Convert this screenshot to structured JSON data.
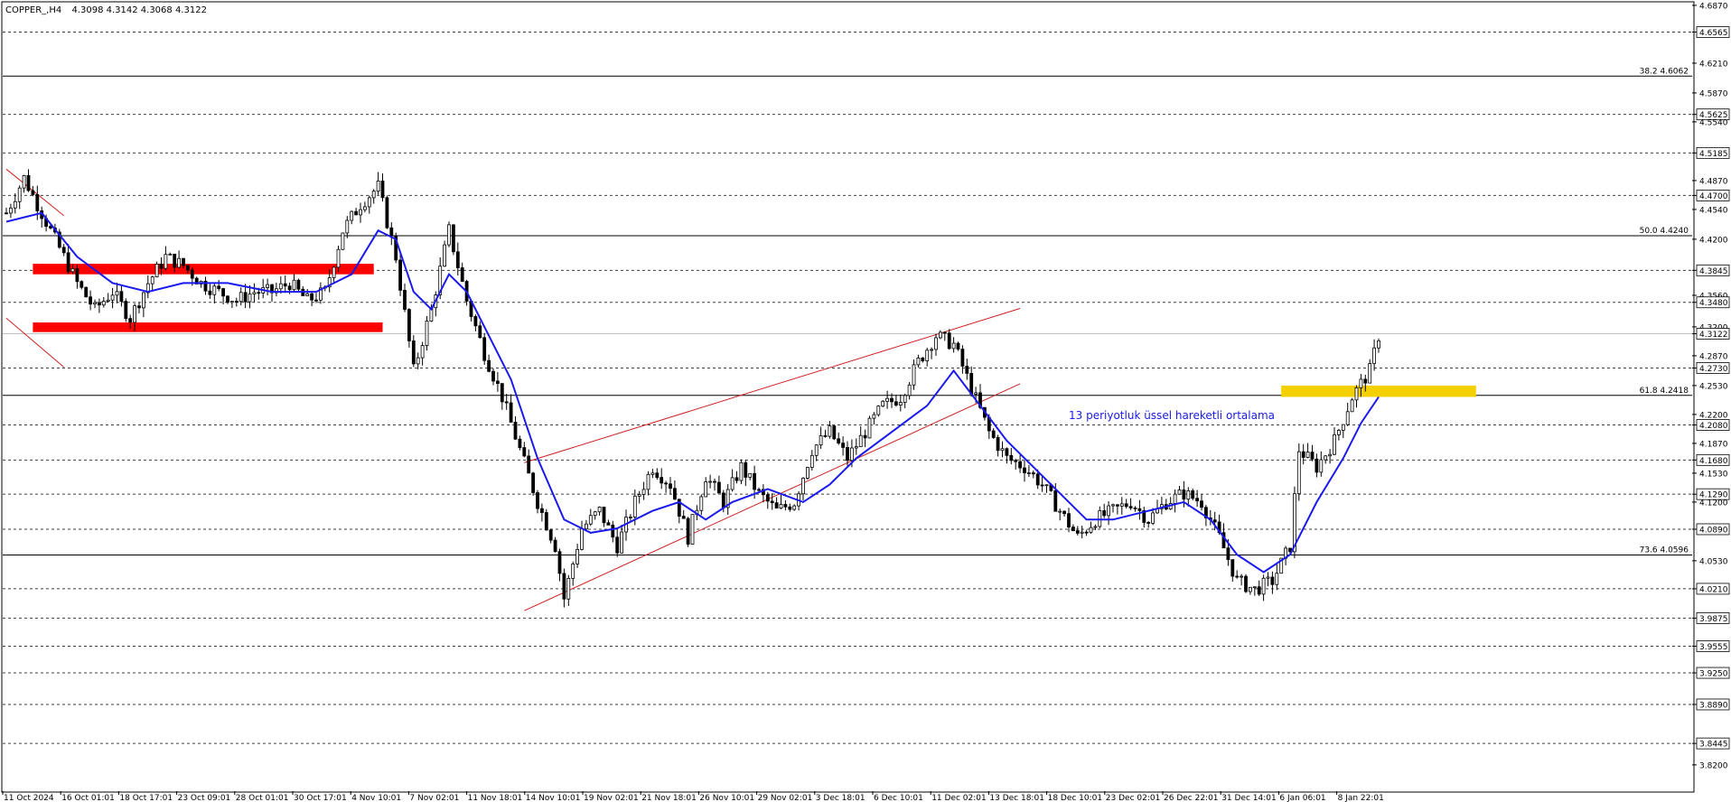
{
  "header": {
    "symbol": "COPPER_,H4",
    "ohlc": "4.3098 4.3142 4.3068 4.3122"
  },
  "annotation": {
    "ema_label": "13 periyotluk üssel hareketli ortalama"
  },
  "colors": {
    "candle": "#000000",
    "ema": "#1a1aee",
    "channel": "#cc2020",
    "zone_red": "#ff0000",
    "zone_yellow": "#f5d000",
    "grid": "#000000",
    "fib_line": "#000000",
    "current_price_line": "#c0c0c0"
  },
  "chart_data": {
    "type": "candlestick",
    "timeframe": "H4",
    "ylim": [
      3.79,
      4.69
    ],
    "y_ticks": [
      "4.6870",
      "4.6565",
      "4.6210",
      "4.5870",
      "4.5625",
      "4.5540",
      "4.5185",
      "4.4870",
      "4.4700",
      "4.4540",
      "4.4200",
      "4.3845",
      "4.3560",
      "4.3480",
      "4.3200",
      "4.3122",
      "4.2870",
      "4.2730",
      "4.2530",
      "4.2200",
      "4.2080",
      "4.1870",
      "4.1680",
      "4.1530",
      "4.1290",
      "4.1200",
      "4.0890",
      "4.0530",
      "4.0210",
      "3.9875",
      "3.9555",
      "3.9250",
      "3.8890",
      "3.8445",
      "3.8200"
    ],
    "highlighted_levels": [
      "4.6565",
      "4.5625",
      "4.5185",
      "4.4700",
      "4.3845",
      "4.3480",
      "4.3122",
      "4.2730",
      "4.2080",
      "4.1680",
      "4.1290",
      "4.0890",
      "4.0210",
      "3.9875",
      "3.9555",
      "3.9250",
      "3.8890",
      "3.8445"
    ],
    "dashed_levels": [
      4.6565,
      4.5625,
      4.5185,
      4.47,
      4.3845,
      4.348,
      4.273,
      4.208,
      4.168,
      4.129,
      4.089,
      4.021,
      3.9875,
      3.9555,
      3.925,
      3.889,
      3.8445
    ],
    "current_price": 4.3122,
    "fibonacci": [
      {
        "label": "38.2 4.6062",
        "price": 4.6062
      },
      {
        "label": "50.0 4.4240",
        "price": 4.424
      },
      {
        "label": "61.8 4.2418",
        "price": 4.2418
      },
      {
        "label": "73.6 4.0596",
        "price": 4.0596
      }
    ],
    "x_labels": [
      "11 Oct 2024",
      "16 Oct 01:01",
      "18 Oct 17:01",
      "23 Oct 09:01",
      "28 Oct 01:01",
      "30 Oct 17:01",
      "4 Nov 10:01",
      "7 Nov 02:01",
      "11 Nov 18:01",
      "14 Nov 10:01",
      "19 Nov 02:01",
      "21 Nov 18:01",
      "26 Nov 10:01",
      "29 Nov 02:01",
      "3 Dec 18:01",
      "6 Dec 10:01",
      "11 Dec 02:01",
      "13 Dec 18:01",
      "18 Dec 10:01",
      "23 Dec 02:01",
      "26 Dec 22:01",
      "31 Dec 14:01",
      "6 Jan 06:01",
      "8 Jan 22:01"
    ],
    "close_path": [
      [
        0,
        4.45
      ],
      [
        4,
        4.49
      ],
      [
        8,
        4.45
      ],
      [
        12,
        4.41
      ],
      [
        16,
        4.37
      ],
      [
        20,
        4.34
      ],
      [
        24,
        4.36
      ],
      [
        28,
        4.33
      ],
      [
        32,
        4.37
      ],
      [
        36,
        4.4
      ],
      [
        40,
        4.39
      ],
      [
        44,
        4.37
      ],
      [
        48,
        4.36
      ],
      [
        52,
        4.35
      ],
      [
        56,
        4.36
      ],
      [
        60,
        4.36
      ],
      [
        64,
        4.37
      ],
      [
        68,
        4.35
      ],
      [
        72,
        4.36
      ],
      [
        76,
        4.43
      ],
      [
        80,
        4.46
      ],
      [
        84,
        4.48
      ],
      [
        88,
        4.4
      ],
      [
        92,
        4.27
      ],
      [
        96,
        4.34
      ],
      [
        100,
        4.43
      ],
      [
        104,
        4.35
      ],
      [
        108,
        4.29
      ],
      [
        112,
        4.24
      ],
      [
        116,
        4.18
      ],
      [
        120,
        4.12
      ],
      [
        124,
        4.07
      ],
      [
        126,
        4.01
      ],
      [
        130,
        4.09
      ],
      [
        134,
        4.11
      ],
      [
        138,
        4.07
      ],
      [
        142,
        4.12
      ],
      [
        146,
        4.16
      ],
      [
        150,
        4.14
      ],
      [
        154,
        4.08
      ],
      [
        158,
        4.15
      ],
      [
        162,
        4.12
      ],
      [
        166,
        4.16
      ],
      [
        170,
        4.13
      ],
      [
        174,
        4.11
      ],
      [
        178,
        4.12
      ],
      [
        182,
        4.18
      ],
      [
        186,
        4.2
      ],
      [
        190,
        4.17
      ],
      [
        194,
        4.2
      ],
      [
        198,
        4.23
      ],
      [
        202,
        4.24
      ],
      [
        206,
        4.28
      ],
      [
        210,
        4.31
      ],
      [
        214,
        4.3
      ],
      [
        218,
        4.25
      ],
      [
        222,
        4.2
      ],
      [
        226,
        4.17
      ],
      [
        230,
        4.16
      ],
      [
        234,
        4.14
      ],
      [
        238,
        4.11
      ],
      [
        242,
        4.08
      ],
      [
        246,
        4.1
      ],
      [
        250,
        4.11
      ],
      [
        254,
        4.12
      ],
      [
        258,
        4.1
      ],
      [
        262,
        4.12
      ],
      [
        266,
        4.13
      ],
      [
        270,
        4.12
      ],
      [
        274,
        4.08
      ],
      [
        278,
        4.03
      ],
      [
        282,
        4.02
      ],
      [
        286,
        4.03
      ],
      [
        290,
        4.07
      ],
      [
        292,
        4.18
      ],
      [
        296,
        4.16
      ],
      [
        300,
        4.19
      ],
      [
        304,
        4.24
      ],
      [
        308,
        4.27
      ],
      [
        310,
        4.31
      ]
    ],
    "ema13_path": [
      [
        0,
        4.44
      ],
      [
        8,
        4.45
      ],
      [
        16,
        4.4
      ],
      [
        24,
        4.37
      ],
      [
        32,
        4.36
      ],
      [
        40,
        4.37
      ],
      [
        50,
        4.37
      ],
      [
        60,
        4.36
      ],
      [
        70,
        4.36
      ],
      [
        78,
        4.38
      ],
      [
        84,
        4.43
      ],
      [
        88,
        4.42
      ],
      [
        92,
        4.36
      ],
      [
        96,
        4.34
      ],
      [
        100,
        4.38
      ],
      [
        104,
        4.36
      ],
      [
        108,
        4.32
      ],
      [
        114,
        4.26
      ],
      [
        120,
        4.17
      ],
      [
        126,
        4.1
      ],
      [
        132,
        4.085
      ],
      [
        138,
        4.09
      ],
      [
        146,
        4.11
      ],
      [
        152,
        4.12
      ],
      [
        158,
        4.1
      ],
      [
        164,
        4.12
      ],
      [
        172,
        4.135
      ],
      [
        180,
        4.12
      ],
      [
        186,
        4.14
      ],
      [
        192,
        4.17
      ],
      [
        200,
        4.2
      ],
      [
        208,
        4.23
      ],
      [
        214,
        4.27
      ],
      [
        220,
        4.23
      ],
      [
        226,
        4.19
      ],
      [
        232,
        4.16
      ],
      [
        238,
        4.13
      ],
      [
        244,
        4.1
      ],
      [
        250,
        4.1
      ],
      [
        258,
        4.11
      ],
      [
        266,
        4.12
      ],
      [
        272,
        4.1
      ],
      [
        278,
        4.06
      ],
      [
        284,
        4.04
      ],
      [
        290,
        4.06
      ],
      [
        296,
        4.12
      ],
      [
        302,
        4.17
      ],
      [
        306,
        4.21
      ],
      [
        310,
        4.24
      ]
    ],
    "zones": [
      {
        "kind": "red",
        "i0": 6,
        "i1": 83,
        "p_top": 4.392,
        "p_bot": 4.38
      },
      {
        "kind": "red",
        "i0": 6,
        "i1": 85,
        "p_top": 4.325,
        "p_bot": 4.314
      },
      {
        "kind": "yellow",
        "i0": 288,
        "i1": 332,
        "p_top": 4.253,
        "p_bot": 4.24
      }
    ],
    "trendlines": [
      {
        "i0": 117,
        "p0": 4.165,
        "i1": 229,
        "p1": 4.341
      },
      {
        "i0": 117,
        "p0": 3.996,
        "i1": 229,
        "p1": 4.255
      },
      {
        "i0": 0,
        "p0": 4.5,
        "i1": 13,
        "p1": 4.447
      },
      {
        "i0": 0,
        "p0": 4.33,
        "i1": 13,
        "p1": 4.274
      }
    ],
    "ema_label_anchor": {
      "i": 240,
      "p": 4.215
    },
    "n_bars": 311,
    "bar_noise": 0.012,
    "grid": true
  }
}
